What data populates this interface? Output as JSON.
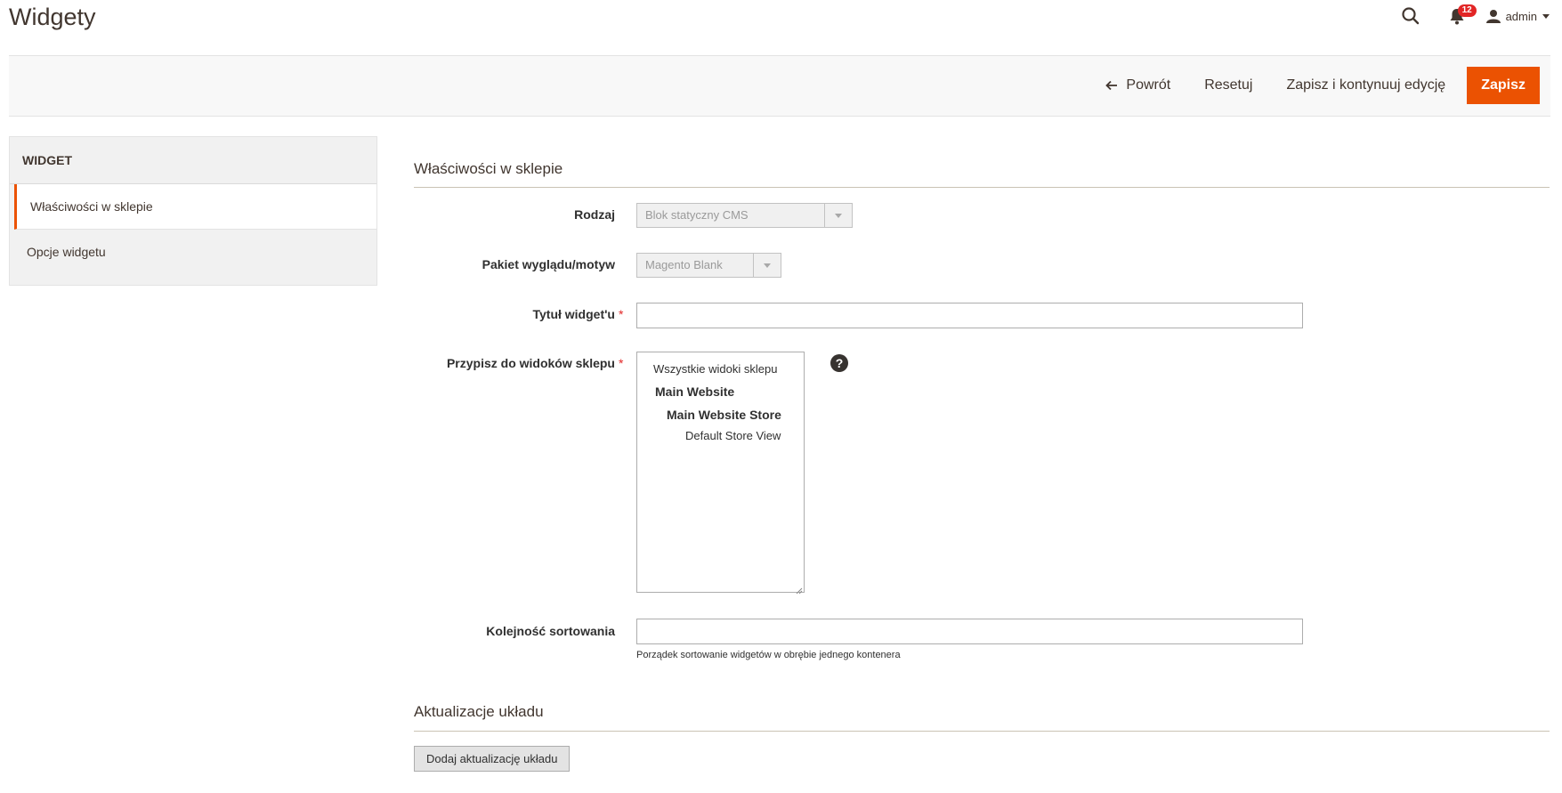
{
  "header": {
    "title": "Widgety",
    "notifications_count": "12",
    "user_name": "admin"
  },
  "toolbar": {
    "back_label": "Powrót",
    "reset_label": "Resetuj",
    "save_continue_label": "Zapisz i kontynuuj edycję",
    "save_label": "Zapisz"
  },
  "sidebar": {
    "title": "WIDGET",
    "tabs": [
      {
        "label": "Właściwości w sklepie",
        "active": true
      },
      {
        "label": "Opcje widgetu",
        "active": false
      }
    ]
  },
  "section_store": {
    "title": "Właściwości w sklepie",
    "type_label": "Rodzaj",
    "type_value": "Blok statyczny CMS",
    "theme_label": "Pakiet wyglądu/motyw",
    "theme_value": "Magento Blank",
    "title_label": "Tytuł widget'u",
    "title_value": "",
    "store_views_label": "Przypisz do widoków sklepu",
    "store_views_options": [
      "Wszystkie widoki sklepu",
      "Main Website",
      "Main Website Store",
      "Default Store View"
    ],
    "help_symbol": "?",
    "sort_label": "Kolejność sortowania",
    "sort_value": "",
    "sort_note": "Porządek sortowanie widgetów w obrębie jednego kontenera",
    "required_mark": "*"
  },
  "section_layout": {
    "title": "Aktualizacje układu",
    "add_button_label": "Dodaj aktualizację układu"
  },
  "colors": {
    "accent": "#eb5202",
    "required": "#e22626",
    "badge": "#e22626"
  },
  "icons": [
    "search-icon",
    "bell-icon",
    "user-icon",
    "arrow-left-icon",
    "help-icon"
  ]
}
